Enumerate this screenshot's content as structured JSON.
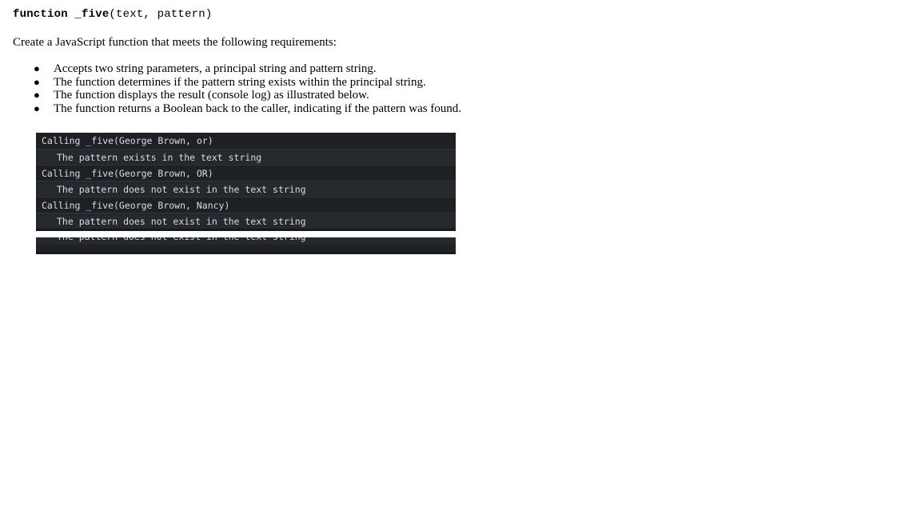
{
  "document": {
    "signature": {
      "name": "function _five",
      "params": "(text, pattern)"
    },
    "intro": "Create a JavaScript function that meets the following requirements:",
    "bullet_glyph": "●",
    "requirements": [
      "Accepts two string parameters, a principal string and pattern string.",
      "The function determines if the pattern string exists within the principal string.",
      "The function displays the result (console log) as illustrated below.",
      "The function returns a Boolean back to the caller, indicating if the pattern was found."
    ]
  },
  "console": {
    "background_color": "#1e2024",
    "alt_row_color": "#25282c",
    "text_color": "#d6dde6",
    "lines": [
      {
        "type": "call",
        "text": "Calling _five(George Brown, or)"
      },
      {
        "type": "result",
        "text": "The pattern exists in the text string"
      },
      {
        "type": "call",
        "text": "Calling _five(George Brown, OR)"
      },
      {
        "type": "result",
        "text": "The pattern does not exist in the text string"
      },
      {
        "type": "call",
        "text": "Calling _five(George Brown, Nancy)"
      },
      {
        "type": "result",
        "text": "The pattern does not exist in the text string"
      }
    ],
    "clipped_fragment": "The pattern does not exist in the text string"
  }
}
